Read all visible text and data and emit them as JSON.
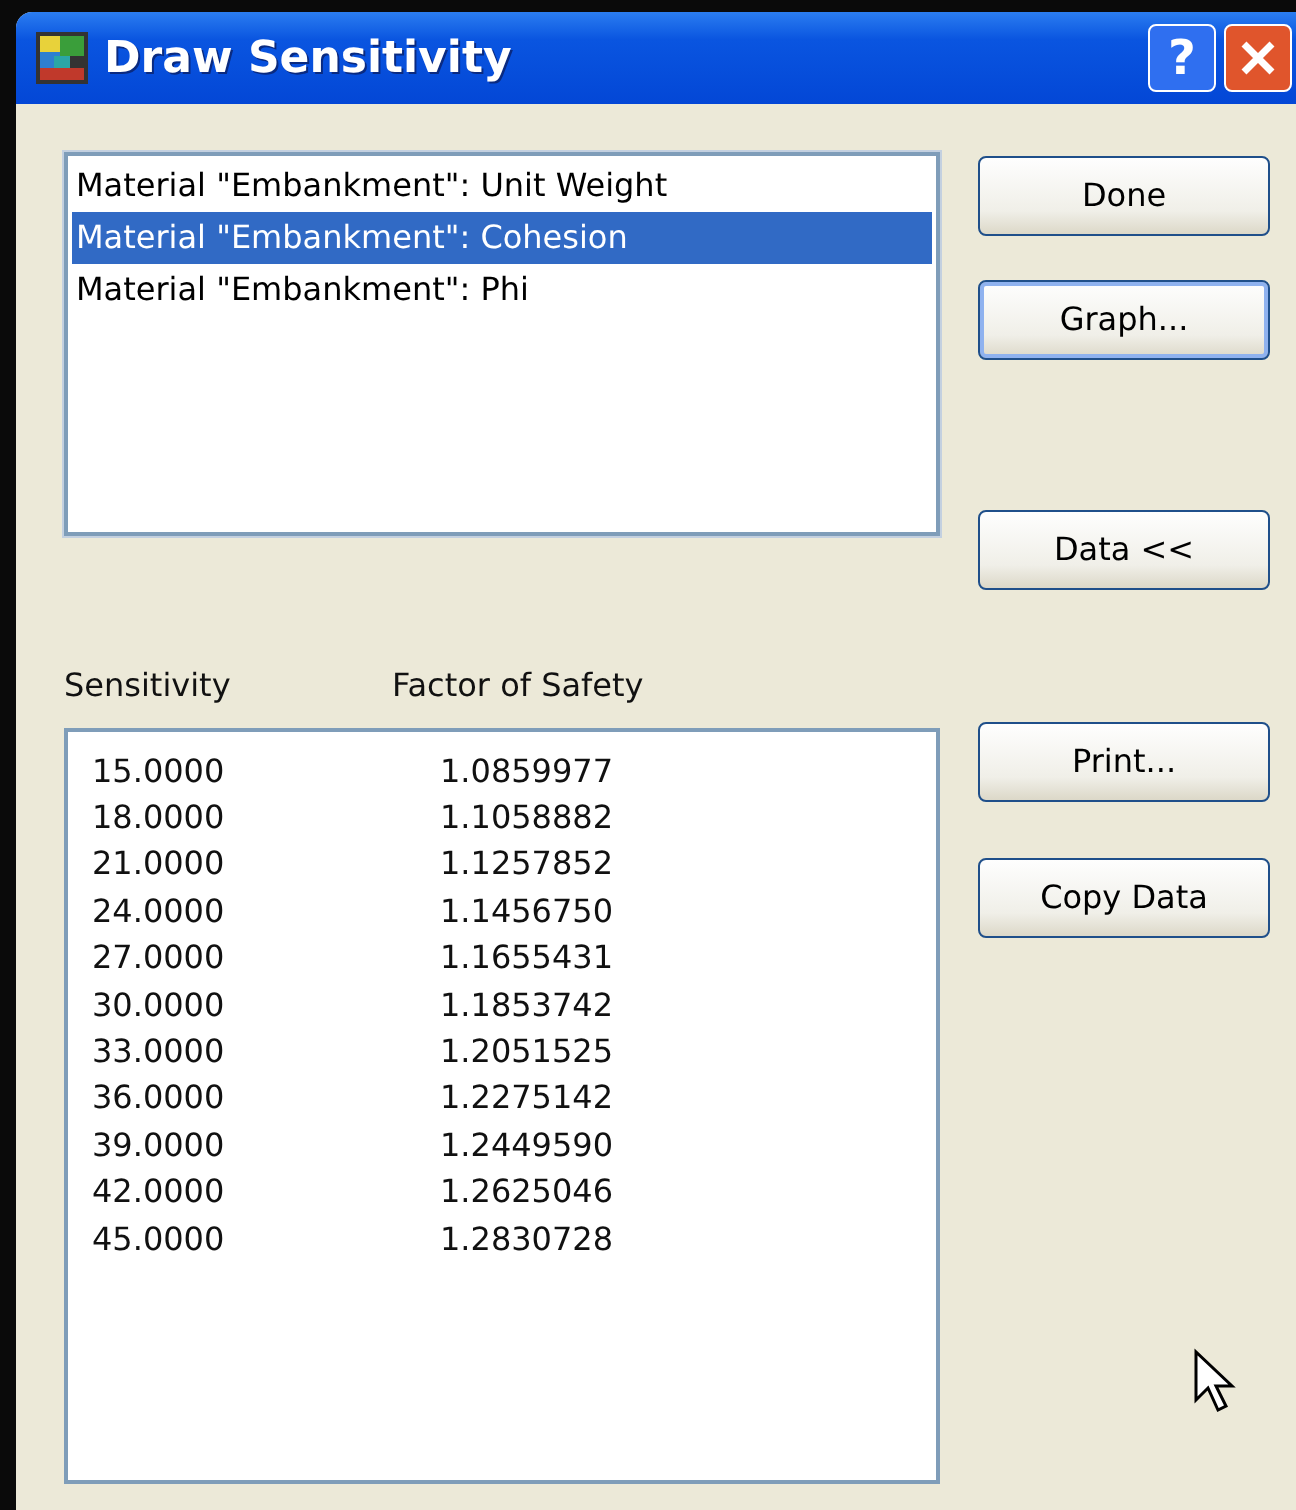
{
  "window": {
    "title": "Draw Sensitivity"
  },
  "title_buttons": [
    {
      "kind": "help",
      "label": "?"
    },
    {
      "kind": "close"
    }
  ],
  "parameter_list": [
    {
      "label": "Material \"Embankment\": Unit Weight",
      "selected": false
    },
    {
      "label": "Material \"Embankment\": Cohesion",
      "selected": true
    },
    {
      "label": "Material \"Embankment\": Phi",
      "selected": false
    }
  ],
  "table": {
    "columns": [
      "Sensitivity",
      "Factor of Safety"
    ],
    "rows": [
      [
        "15.0000",
        "1.0859977"
      ],
      [
        "18.0000",
        "1.1058882"
      ],
      [
        "21.0000",
        "1.1257852"
      ],
      [
        "24.0000",
        "1.1456750"
      ],
      [
        "27.0000",
        "1.1655431"
      ],
      [
        "30.0000",
        "1.1853742"
      ],
      [
        "33.0000",
        "1.2051525"
      ],
      [
        "36.0000",
        "1.2275142"
      ],
      [
        "39.0000",
        "1.2449590"
      ],
      [
        "42.0000",
        "1.2625046"
      ],
      [
        "45.0000",
        "1.2830728"
      ]
    ]
  },
  "buttons": [
    {
      "label": "Done",
      "focused": false
    },
    {
      "label": "Graph...",
      "focused": true
    },
    {
      "label": "Data <<",
      "focused": false
    },
    {
      "label": "Print...",
      "focused": false
    },
    {
      "label": "Copy Data",
      "focused": false
    }
  ]
}
